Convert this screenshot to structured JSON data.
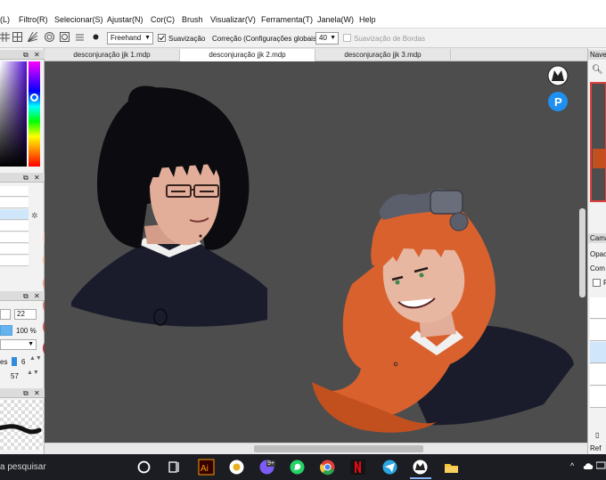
{
  "menu": [
    "(L)",
    "Filtro(R)",
    "Selecionar(S)",
    "Ajustar(N)",
    "Cor(C)",
    "Brush",
    "Visualizar(V)",
    "Ferramenta(T)",
    "Janela(W)",
    "Help"
  ],
  "toolbar": {
    "brush_mode": "Freehand",
    "smoothing_label": "Suavização",
    "smoothing_checked": true,
    "correction_label": "Correção (Configurações globais)",
    "correction_value": "40",
    "edge_smoothing_label": "Suavização de Bordas",
    "edge_smoothing_checked": false
  },
  "tabs": [
    {
      "label": "desconjuração jjk 1.mdp",
      "active": false
    },
    {
      "label": "desconjuração jjk 2.mdp",
      "active": true
    },
    {
      "label": "desconjuração jjk 3.mdp",
      "active": false
    }
  ],
  "left_panel": {
    "brush_size": "22",
    "opacity": "100 %",
    "density_label": "es",
    "density_value": "6",
    "blur_value": "57"
  },
  "color_palette": [
    "#f8d3bf",
    "#eab8a0",
    "#dd9b8b",
    "#d07a74",
    "#c45556",
    "#a8313c",
    "#6e1a20"
  ],
  "right_panel": {
    "navigator_label": "Nave",
    "layers_label": "Cama",
    "opacity_label": "Opac",
    "blend_label": "Com",
    "checkbox_label": "P",
    "refs_label": "Ref"
  },
  "canvas_overlay": {
    "pixiv_letter": "P"
  },
  "taskbar": {
    "search_text": "a pesquisar",
    "apps": [
      {
        "name": "windows-start",
        "color": "#ffffff"
      },
      {
        "name": "cortana",
        "color": "#ffffff"
      },
      {
        "name": "task-view",
        "color": "#ffffff"
      },
      {
        "name": "illustrator",
        "color": "#ff9a00"
      },
      {
        "name": "app-circle",
        "color": "#ffffff"
      },
      {
        "name": "social-app",
        "color": "#7b5cf7"
      },
      {
        "name": "whatsapp",
        "color": "#25d366"
      },
      {
        "name": "chrome",
        "color": "#e34133"
      },
      {
        "name": "netflix",
        "color": "#e50914"
      },
      {
        "name": "telegram",
        "color": "#2ca5e0"
      },
      {
        "name": "medibang",
        "color": "#ffffff"
      },
      {
        "name": "file-explorer",
        "color": "#f4c430"
      }
    ],
    "badge_text": "9+"
  }
}
